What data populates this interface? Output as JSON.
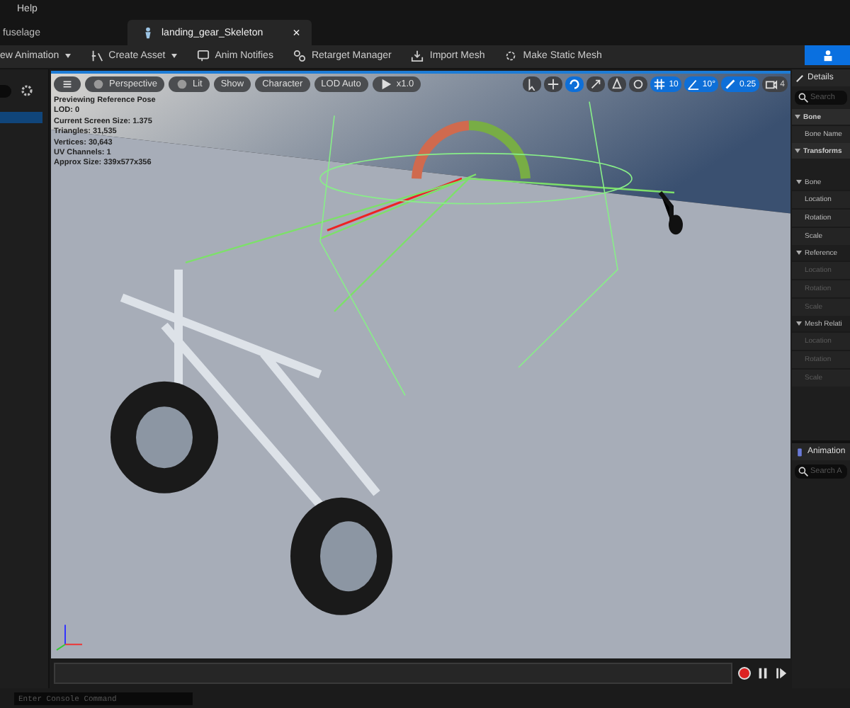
{
  "menu": [
    "Help"
  ],
  "tabs": [
    {
      "label": "fuselage",
      "selected": false
    },
    {
      "label": "landing_gear_Skeleton",
      "selected": true,
      "close": "×"
    }
  ],
  "toolbar": [
    {
      "label": "ew Animation",
      "kind": "plain",
      "dropdown": true
    },
    {
      "label": "Create Asset",
      "kind": "asset",
      "dropdown": true
    },
    {
      "label": "Anim Notifies",
      "kind": "notify",
      "dropdown": false
    },
    {
      "label": "Retarget Manager",
      "kind": "retarget",
      "dropdown": false
    },
    {
      "label": "Import Mesh",
      "kind": "import",
      "dropdown": false
    },
    {
      "label": "Make Static Mesh",
      "kind": "static",
      "dropdown": false
    }
  ],
  "viewport": {
    "pills": [
      {
        "kind": "menu"
      },
      {
        "kind": "sphere",
        "label": "Perspective"
      },
      {
        "kind": "sphere",
        "label": "Lit"
      },
      {
        "kind": "text",
        "label": "Show"
      },
      {
        "kind": "text",
        "label": "Character"
      },
      {
        "kind": "text",
        "label": "LOD Auto"
      },
      {
        "kind": "play",
        "label": "x1.0"
      }
    ],
    "stats": [
      "Previewing Reference Pose",
      "LOD: 0",
      "Current Screen Size: 1.375",
      "Triangles: 31,535",
      "Vertices: 30,643",
      "UV Channels: 1",
      "Approx Size: 339x577x356"
    ],
    "tools": [
      {
        "kind": "select",
        "selected": false
      },
      {
        "kind": "move",
        "selected": false
      },
      {
        "kind": "rotate",
        "selected": true
      },
      {
        "kind": "scale",
        "selected": false
      },
      {
        "kind": "surface",
        "selected": false
      },
      {
        "kind": "local",
        "selected": false
      },
      {
        "kind": "grid",
        "selected": true,
        "label": "10"
      },
      {
        "kind": "angle",
        "selected": true,
        "label": "10°"
      },
      {
        "kind": "scalesnap",
        "selected": true,
        "label": "0.25"
      },
      {
        "kind": "camera",
        "selected": false,
        "label": "4"
      }
    ]
  },
  "details": {
    "title": "Details",
    "search": {
      "placeholder": "Search"
    },
    "items": [
      {
        "kind": "header",
        "label": "Bone"
      },
      {
        "kind": "row",
        "label": "Bone Name",
        "disabled": false
      },
      {
        "kind": "header",
        "label": "Transforms"
      },
      {
        "kind": "spacer"
      },
      {
        "kind": "subheader",
        "label": "Bone"
      },
      {
        "kind": "row",
        "label": "Location",
        "disabled": false
      },
      {
        "kind": "row",
        "label": "Rotation",
        "disabled": false
      },
      {
        "kind": "row",
        "label": "Scale",
        "disabled": false
      },
      {
        "kind": "subheader",
        "label": "Reference"
      },
      {
        "kind": "row",
        "label": "Location",
        "disabled": true
      },
      {
        "kind": "row",
        "label": "Rotation",
        "disabled": true
      },
      {
        "kind": "row",
        "label": "Scale",
        "disabled": true
      },
      {
        "kind": "subheader",
        "label": "Mesh Relati"
      },
      {
        "kind": "row",
        "label": "Location",
        "disabled": true
      },
      {
        "kind": "row",
        "label": "Rotation",
        "disabled": true
      },
      {
        "kind": "row",
        "label": "Scale",
        "disabled": true
      }
    ]
  },
  "animation": {
    "title": "Animation",
    "search": {
      "placeholder": "Search A"
    }
  },
  "console": {
    "placeholder": "Enter Console Command"
  }
}
